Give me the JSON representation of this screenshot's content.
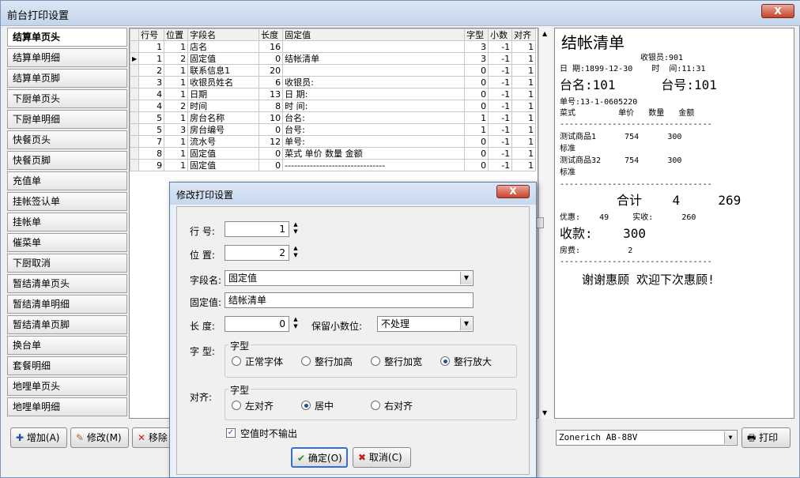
{
  "window": {
    "title": "前台打印设置",
    "close": "X"
  },
  "sidebar": {
    "items": [
      "结算单页头",
      "结算单明细",
      "结算单页脚",
      "下厨单页头",
      "下厨单明细",
      "快餐页头",
      "快餐页脚",
      "充值单",
      "挂帐签认单",
      "挂帐单",
      "催菜单",
      "下厨取消",
      "暂结清单页头",
      "暂结清单明细",
      "暂结清单页脚",
      "换台单",
      "套餐明细",
      "地哩单页头",
      "地哩单明细"
    ]
  },
  "grid": {
    "columns": [
      "行号",
      "位置",
      "字段名",
      "长度",
      "固定值",
      "字型",
      "小数",
      "对齐"
    ],
    "rows": [
      [
        "1",
        "1",
        "店名",
        "16",
        "",
        "3",
        "-1",
        "1"
      ],
      [
        "1",
        "2",
        "固定值",
        "0",
        "结帐清单",
        "3",
        "-1",
        "1"
      ],
      [
        "2",
        "1",
        "联系信息1",
        "20",
        "",
        "0",
        "-1",
        "1"
      ],
      [
        "3",
        "1",
        "收银员姓名",
        "6",
        "收银员:",
        "0",
        "-1",
        "1"
      ],
      [
        "4",
        "1",
        "日期",
        "13",
        "日 期:",
        "0",
        "-1",
        "1"
      ],
      [
        "4",
        "2",
        "时间",
        "8",
        "时 间:",
        "0",
        "-1",
        "1"
      ],
      [
        "5",
        "1",
        "房台名称",
        "10",
        "台名:",
        "1",
        "-1",
        "1"
      ],
      [
        "5",
        "3",
        "房台编号",
        "0",
        "台号:",
        "1",
        "-1",
        "1"
      ],
      [
        "7",
        "1",
        "流水号",
        "12",
        "单号:",
        "0",
        "-1",
        "1"
      ],
      [
        "8",
        "1",
        "固定值",
        "0",
        "菜式 单价 数量 金额",
        "0",
        "-1",
        "1"
      ],
      [
        "9",
        "1",
        "固定值",
        "0",
        "--------------------------------",
        "0",
        "-1",
        "1"
      ]
    ],
    "selected_row": 1
  },
  "preview": {
    "title": "结帐清单",
    "cashier": "收银员:901",
    "date_line": "日 期:1899-12-30    时  间:11:31",
    "table_line": "台名:101      台号:101",
    "order_no": "单号:13-1-0605220",
    "header": "菜式         单价   数量   金额",
    "sep": "--------------------------------",
    "item1": "测试商品1      754      300",
    "std1": "标准",
    "item2": "测试商品32     754      300",
    "std2": "标准",
    "total": "合计    4     269",
    "discount": "优惠:    49     实收:      260",
    "received": "收款:    300",
    "room_fee": "房费:          2",
    "thanks": "谢谢惠顾 欢迎下次惠顾!"
  },
  "toolbar": {
    "add": "增加(A)",
    "modify": "修改(M)",
    "remove": "移除",
    "printer": "Zonerich AB-88V",
    "print": "打印"
  },
  "dialog": {
    "title": "修改打印设置",
    "close": "X",
    "row_label": "行  号:",
    "row_value": "1",
    "pos_label": "位  置:",
    "pos_value": "2",
    "field_label": "字段名:",
    "field_value": "固定值",
    "fixed_label": "固定值:",
    "fixed_value": "结帐清单",
    "len_label": "长  度:",
    "len_value": "0",
    "decimal_label": "保留小数位:",
    "decimal_value": "不处理",
    "font_label": "字  型:",
    "font_group": "字型",
    "font_options": [
      "正常字体",
      "整行加高",
      "整行加宽",
      "整行放大"
    ],
    "align_label": "对齐:",
    "align_group": "字型",
    "align_options": [
      "左对齐",
      "居中",
      "右对齐"
    ],
    "blank_no_output": "空值时不输出",
    "ok": "确定(O)",
    "cancel": "取消(C)"
  }
}
